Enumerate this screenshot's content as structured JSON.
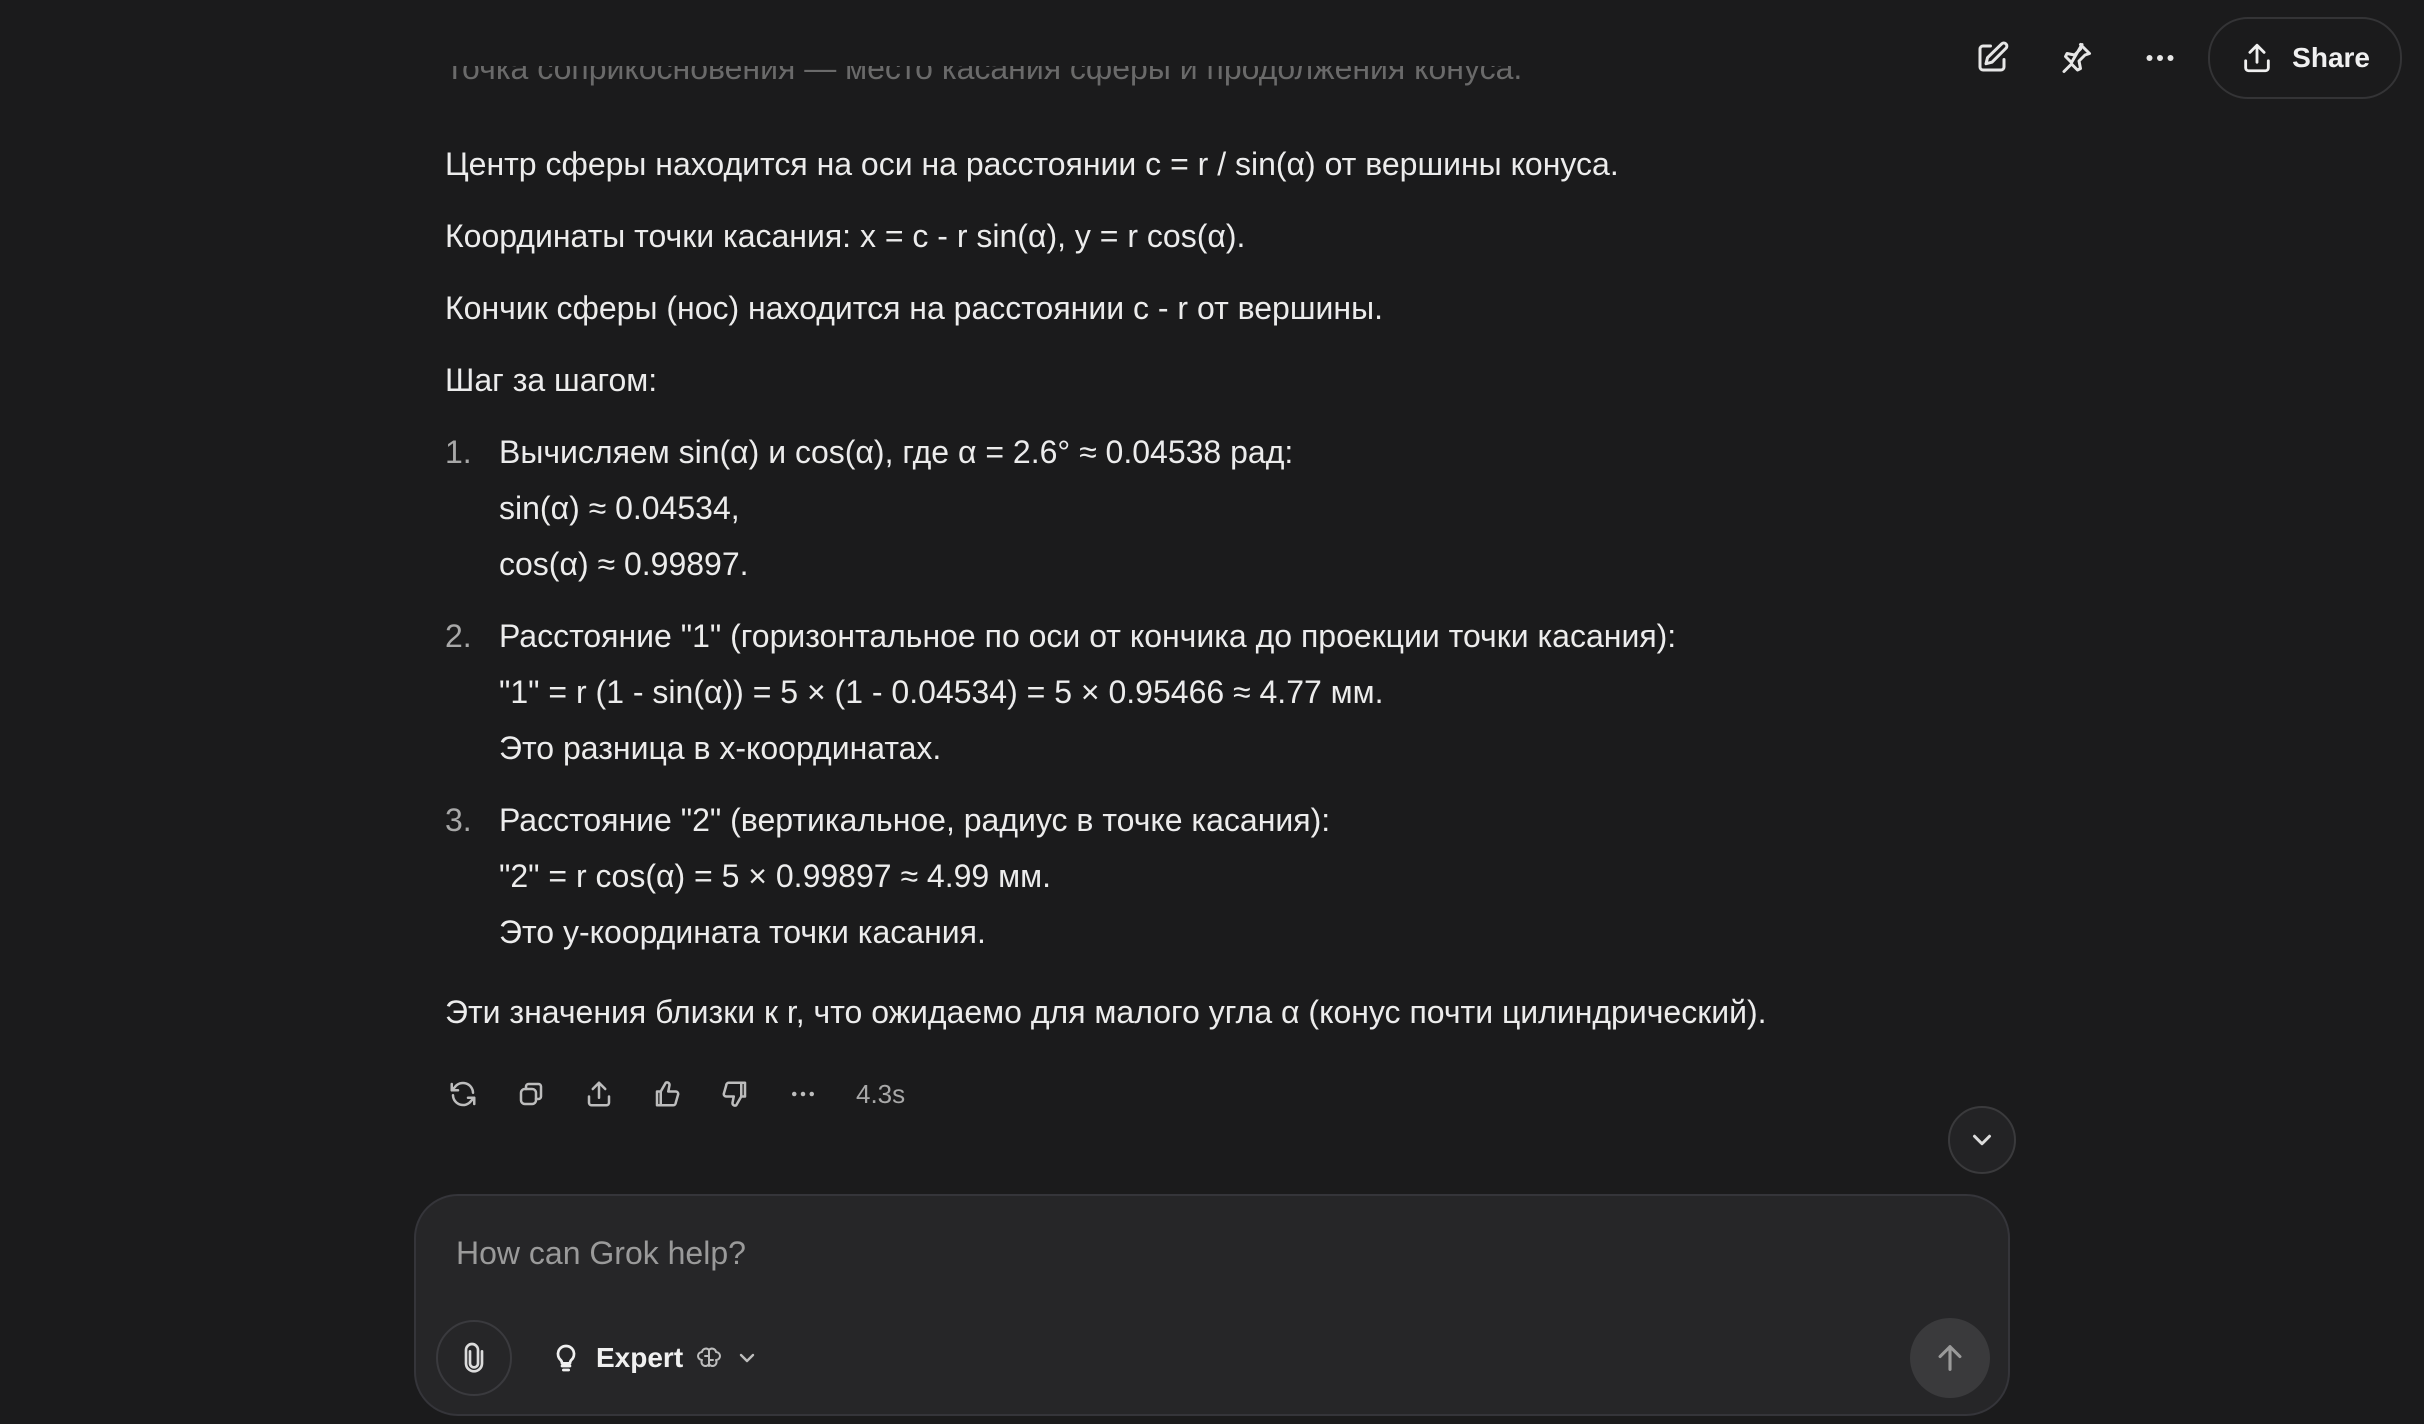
{
  "header": {
    "icons": [
      "edit-icon",
      "pin-icon",
      "more-icon"
    ],
    "share_label": "Share"
  },
  "message": {
    "faded_line": "Точка соприкосновения — место касания сферы и продолжения конуса.",
    "p1": "Центр сферы находится на оси на расстоянии c = r / sin(α) от вершины конуса.",
    "p2": "Координаты точки касания: x = c - r sin(α), y = r cos(α).",
    "p3": "Кончик сферы (нос) находится на расстоянии c - r от вершины.",
    "p4": "Шаг за шагом:",
    "steps": [
      {
        "num": "1.",
        "lines": [
          "Вычисляем sin(α) и cos(α), где α = 2.6° ≈ 0.04538 рад:",
          "sin(α) ≈ 0.04534,",
          "cos(α) ≈ 0.99897."
        ]
      },
      {
        "num": "2.",
        "lines": [
          "Расстояние \"1\" (горизонтальное по оси от кончика до проекции точки касания):",
          "\"1\" = r (1 - sin(α)) = 5 × (1 - 0.04534) = 5 × 0.95466 ≈ 4.77 мм.",
          "Это разница в x-координатах."
        ]
      },
      {
        "num": "3.",
        "lines": [
          "Расстояние \"2\" (вертикальное, радиус в точке касания):",
          "\"2\" = r cos(α) = 5 × 0.99897 ≈ 4.99 мм.",
          "Это y-координата точки касания."
        ]
      }
    ],
    "p5": "Эти значения близки к r, что ожидаемо для малого угла α (конус почти цилиндрический)."
  },
  "actions": {
    "icons": [
      "regenerate-icon",
      "copy-icon",
      "share-icon",
      "thumbs-up-icon",
      "thumbs-down-icon",
      "more-icon"
    ],
    "time": "4.3s"
  },
  "composer": {
    "placeholder": "How can Grok help?",
    "mode_label": "Expert"
  }
}
